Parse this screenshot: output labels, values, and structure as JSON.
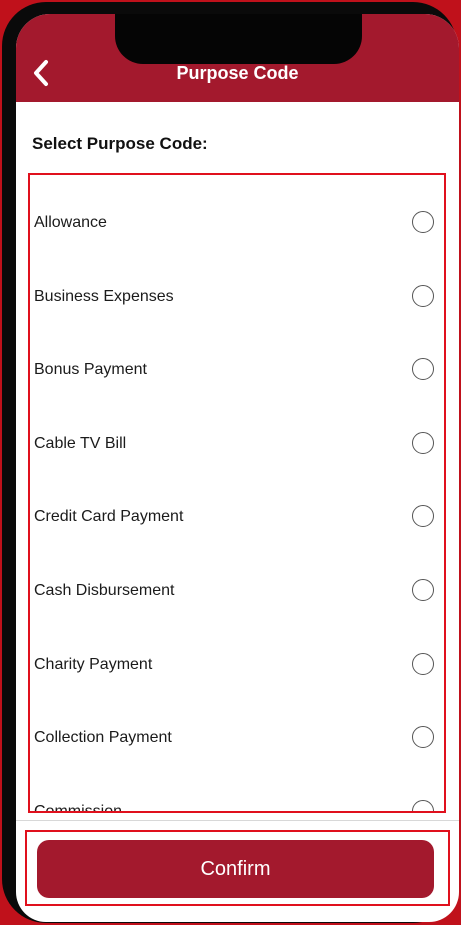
{
  "header": {
    "title": "Purpose Code",
    "back_icon": "chevron-left-icon"
  },
  "section": {
    "label": "Select Purpose Code:"
  },
  "purpose_codes": [
    {
      "label": "Allowance",
      "selected": false
    },
    {
      "label": "Business Expenses",
      "selected": false
    },
    {
      "label": "Bonus Payment",
      "selected": false
    },
    {
      "label": "Cable TV Bill",
      "selected": false
    },
    {
      "label": "Credit Card Payment",
      "selected": false
    },
    {
      "label": "Cash Disbursement",
      "selected": false
    },
    {
      "label": "Charity Payment",
      "selected": false
    },
    {
      "label": "Collection Payment",
      "selected": false
    },
    {
      "label": "Commission",
      "selected": false
    }
  ],
  "footer": {
    "confirm_label": "Confirm"
  },
  "colors": {
    "brand": "#a3192d",
    "highlight_border": "#e0101d",
    "background": "#c0111b"
  }
}
